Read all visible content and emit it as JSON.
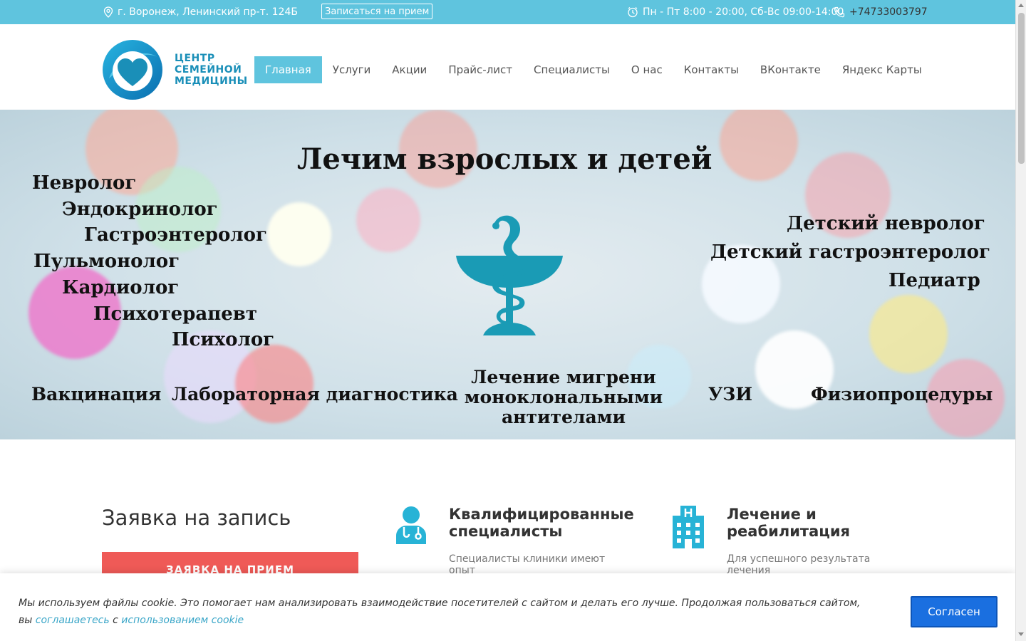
{
  "topbar": {
    "address": "г. Воронеж, Ленинский пр-т. 124Б",
    "appointment_button": "Записаться на прием",
    "hours": "Пн - Пт 8:00 - 20:00, Сб-Вс 09:00-14:00",
    "phone": "+74733003797"
  },
  "logo": {
    "line1": "ЦЕНТР",
    "line2": "СЕМЕЙНОЙ",
    "line3": "МЕДИЦИНЫ"
  },
  "nav": {
    "items": [
      "Главная",
      "Услуги",
      "Акции",
      "Прайс-лист",
      "Специалисты",
      "О нас",
      "Контакты",
      "ВКонтакте",
      "Яндекс Карты"
    ],
    "active": "Главная"
  },
  "banner": {
    "headline": "Лечим взрослых и детей",
    "left_specialists": [
      "Невролог",
      "Эндокринолог",
      "Гастроэнтеролог",
      "Пульмонолог",
      "Кардиолог",
      "Психотерапевт",
      "Психолог"
    ],
    "right_specialists": [
      "Детский невролог",
      "Детский гастроэнтеролог",
      "Педиатр"
    ],
    "bottom_services": [
      "Вакцинация",
      "Лабораторная диагностика",
      "Лечение мигрени моноклональными антителами",
      "УЗИ",
      "Физиопроцедуры"
    ]
  },
  "form": {
    "title": "Заявка на запись",
    "button": "ЗАЯВКА НА ПРИЕМ"
  },
  "features": [
    {
      "title": "Квалифицированные специалисты",
      "text": "Специалисты клиники имеют опыт",
      "icon": "doctor-icon"
    },
    {
      "title": "Лечение и реабилитация",
      "text": "Для успешного результата лечения",
      "icon": "hospital-icon"
    }
  ],
  "cookie": {
    "text_before": "Мы используем файлы cookie. Это помогает нам анализировать взаимодействие посетителей с сайтом и делать его лучше. Продолжая пользоваться сайтом, вы ",
    "link1": "соглашаетесь",
    "text_middle": " с ",
    "link2": "использованием cookie",
    "button": "Согласен"
  },
  "colors": {
    "accent": "#5fc4de",
    "logo_blue": "#1a8fb8",
    "form_button": "#ef5a57",
    "cookie_button": "#1a6fe0"
  }
}
